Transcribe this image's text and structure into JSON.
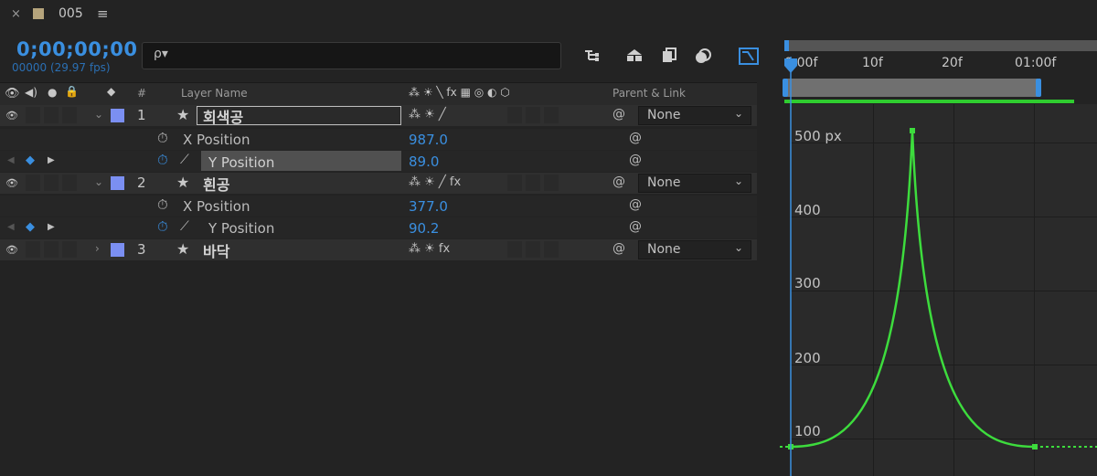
{
  "tab": {
    "close": "×",
    "comp_name": "005",
    "menu": "≡",
    "swatch_color": "#b5a47c"
  },
  "header": {
    "timecode": "0;00;00;00",
    "frames": "00000 (29.97 fps)",
    "search_icon": "ρ▾",
    "search_placeholder": ""
  },
  "toolbar_icons": [
    "compositions-icon",
    "draft-3d-icon",
    "frame-blending-icon",
    "motion-blur-icon",
    "graph-editor-icon"
  ],
  "columns": {
    "hash": "#",
    "layer_name": "Layer Name",
    "switches": "⁂ ☀ ╲ fx ▦ ◎ ◐ ⬡",
    "parent": "Parent & Link"
  },
  "layers": [
    {
      "num": "1",
      "name": "회색공",
      "parent": "None",
      "expanded": true,
      "label_color": "#7b8ff2",
      "props": [
        {
          "name": "X Position",
          "value": "987.0",
          "keyframed": false
        },
        {
          "name": "Y Position",
          "value": "89.0",
          "keyframed": true,
          "selected": true
        }
      ]
    },
    {
      "num": "2",
      "name": "흰공",
      "parent": "None",
      "expanded": true,
      "label_color": "#7b8ff2",
      "props": [
        {
          "name": "X Position",
          "value": "377.0",
          "keyframed": false
        },
        {
          "name": "Y Position",
          "value": "90.2",
          "keyframed": true,
          "selected": false
        }
      ]
    },
    {
      "num": "3",
      "name": "바닥",
      "parent": "None",
      "expanded": false,
      "label_color": "#7b8ff2",
      "props": []
    }
  ],
  "timeline": {
    "ruler_ticks": [
      "0:00f",
      "10f",
      "20f",
      "01:00f"
    ],
    "graph_labels": [
      "500 px",
      "400",
      "300",
      "200",
      "100"
    ],
    "curve_color": "#3ddc3d",
    "playhead_color": "#3a8fe0"
  },
  "chart_data": {
    "type": "line",
    "title": "",
    "xlabel": "",
    "ylabel": "px",
    "x_ticks": [
      "0:00f",
      "10f",
      "20f",
      "01:00f"
    ],
    "y_ticks": [
      500,
      400,
      300,
      200,
      100
    ],
    "series": [
      {
        "points": [
          [
            0,
            89
          ],
          [
            15,
            521
          ],
          [
            30,
            89
          ]
        ]
      }
    ]
  }
}
